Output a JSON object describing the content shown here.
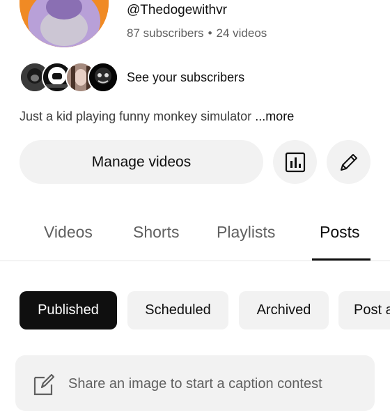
{
  "channel": {
    "handle": "@Thedogewithvr",
    "subscribers": "87 subscribers",
    "separator": "•",
    "videos": "24 videos",
    "see_subscribers": "See your subscribers",
    "description": "Just a kid playing funny monkey simulator",
    "more_label": "...more"
  },
  "actions": {
    "manage_videos": "Manage videos",
    "analytics_icon": "analytics-icon",
    "edit_icon": "pencil-icon"
  },
  "tabs": [
    {
      "label": "Videos"
    },
    {
      "label": "Shorts"
    },
    {
      "label": "Playlists"
    },
    {
      "label": "Posts",
      "active": true
    }
  ],
  "chips": [
    {
      "label": "Published",
      "selected": true
    },
    {
      "label": "Scheduled"
    },
    {
      "label": "Archived"
    },
    {
      "label": "Post a"
    }
  ],
  "composer": {
    "placeholder": "Share an image to start a caption contest"
  },
  "colors": {
    "accent_dark": "#0f0f0f",
    "chip_bg": "#f2f2f2",
    "muted_text": "#606060",
    "avatar_bg": "#f08a24"
  }
}
